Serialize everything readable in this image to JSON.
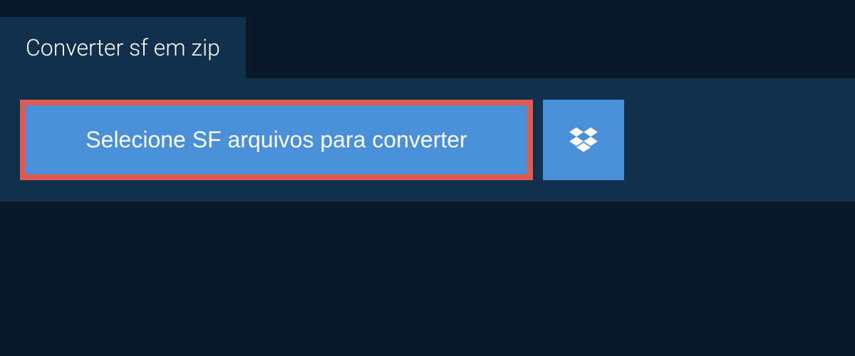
{
  "tab": {
    "title": "Converter sf em zip"
  },
  "selectButton": {
    "label": "Selecione SF arquivos para converter"
  },
  "colors": {
    "background": "#0a1929",
    "panel": "#10304c",
    "buttonPrimary": "#4a90d9",
    "buttonBorder": "#e05a52",
    "text": "#ffffff"
  }
}
